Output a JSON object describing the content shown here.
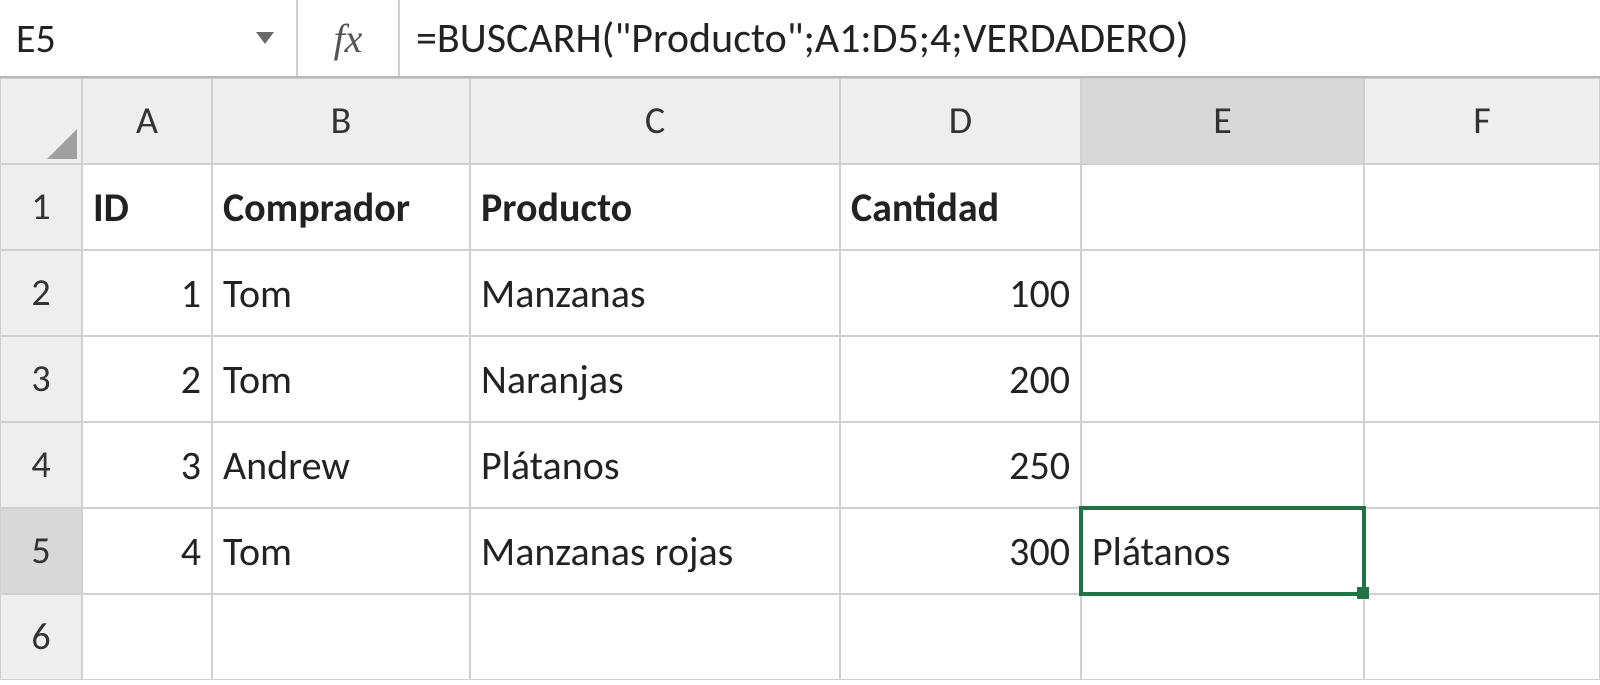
{
  "nameBox": "E5",
  "fxLabel": "fx",
  "formula": "=BUSCARH(\"Producto\";A1:D5;4;VERDADERO)",
  "columns": [
    "A",
    "B",
    "C",
    "D",
    "E",
    "F"
  ],
  "rows": [
    "1",
    "2",
    "3",
    "4",
    "5",
    "6"
  ],
  "selected": {
    "row": "5",
    "col": "E"
  },
  "sheet": {
    "A1": "ID",
    "B1": "Comprador",
    "C1": "Producto",
    "D1": "Cantidad",
    "A2": "1",
    "B2": "Tom",
    "C2": "Manzanas",
    "D2": "100",
    "A3": "2",
    "B3": "Tom",
    "C3": "Naranjas",
    "D3": "200",
    "A4": "3",
    "B4": "Andrew",
    "C4": "Plátanos",
    "D4": "250",
    "A5": "4",
    "B5": "Tom",
    "C5": "Manzanas rojas",
    "D5": "300",
    "E5": "Plátanos"
  }
}
